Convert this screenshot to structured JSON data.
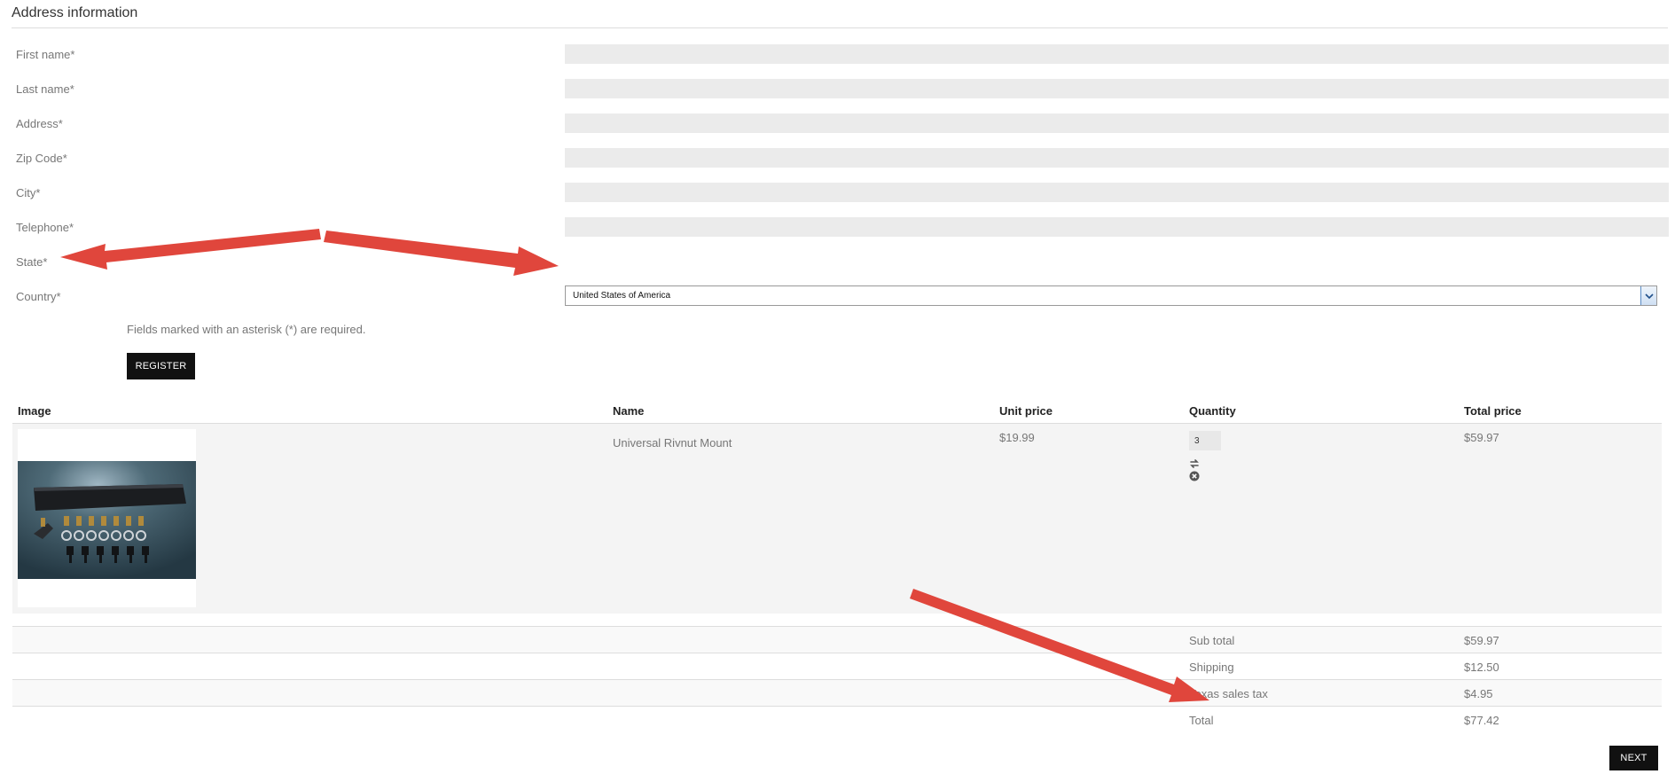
{
  "form": {
    "section_title": "Address information",
    "fields": [
      {
        "label": "First name*",
        "value": ""
      },
      {
        "label": "Last name*",
        "value": ""
      },
      {
        "label": "Address*",
        "value": ""
      },
      {
        "label": "Zip Code*",
        "value": ""
      },
      {
        "label": "City*",
        "value": ""
      },
      {
        "label": "Telephone*",
        "value": ""
      }
    ],
    "state_label": "State*",
    "country_label": "Country*",
    "country_value": "United States of America",
    "required_note": "Fields marked with an asterisk (*) are required.",
    "register_label": "REGISTER"
  },
  "cart": {
    "headers": {
      "image": "Image",
      "name": "Name",
      "unit_price": "Unit price",
      "quantity": "Quantity",
      "total_price": "Total price"
    },
    "items": [
      {
        "name": "Universal Rivnut Mount",
        "unit_price": "$19.99",
        "quantity": "3",
        "total_price": "$59.97",
        "update_icon": "refresh-icon",
        "remove_icon": "remove-icon"
      }
    ]
  },
  "totals": [
    {
      "label": "Sub total",
      "value": "$59.97"
    },
    {
      "label": "Shipping",
      "value": "$12.50"
    },
    {
      "label": "Texas sales tax",
      "value": "$4.95"
    },
    {
      "label": "Total",
      "value": "$77.42"
    }
  ],
  "next_label": "NEXT",
  "colors": {
    "annotation_arrow": "#e0463c",
    "button": "#111111",
    "input_bg": "#ebebeb",
    "row_bg": "#f4f4f4"
  }
}
